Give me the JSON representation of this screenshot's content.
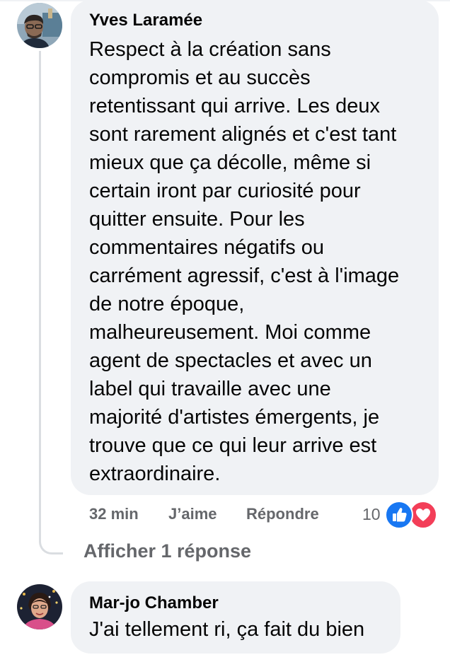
{
  "comments": [
    {
      "author": "Yves Laramée",
      "text_lines": [
        "Respect à la création sans",
        "compromis et au succès",
        "retentissant qui arrive. Les deux",
        "sont rarement alignés et c'est tant",
        "mieux que ça décolle, même si",
        "certain iront par curiosité pour",
        "quitter ensuite. Pour les",
        "commentaires négatifs ou",
        "carrément agressif, c'est à l'image",
        "de notre époque,",
        "malheureusement. Moi comme",
        "agent de spectacles et avec un",
        "label qui travaille avec une",
        "majorité d'artistes émergents, je",
        "trouve que ce qui leur arrive est",
        "extraordinaire."
      ],
      "time": "32 min",
      "like_label": "J’aime",
      "reply_label": "Répondre",
      "reaction_count": "10",
      "reaction_icons": [
        "like-icon",
        "love-icon"
      ],
      "show_replies_label": "Afficher 1 réponse"
    },
    {
      "author": "Mar-jo Chamber",
      "text_lines": [
        "J'ai tellement ri, ça fait du bien"
      ]
    }
  ],
  "colors": {
    "bubble": "#f0f2f5",
    "secondary_text": "#65676b",
    "like_blue": "#1877f2",
    "love_red": "#f33e58",
    "thread_line": "#dadde1"
  }
}
